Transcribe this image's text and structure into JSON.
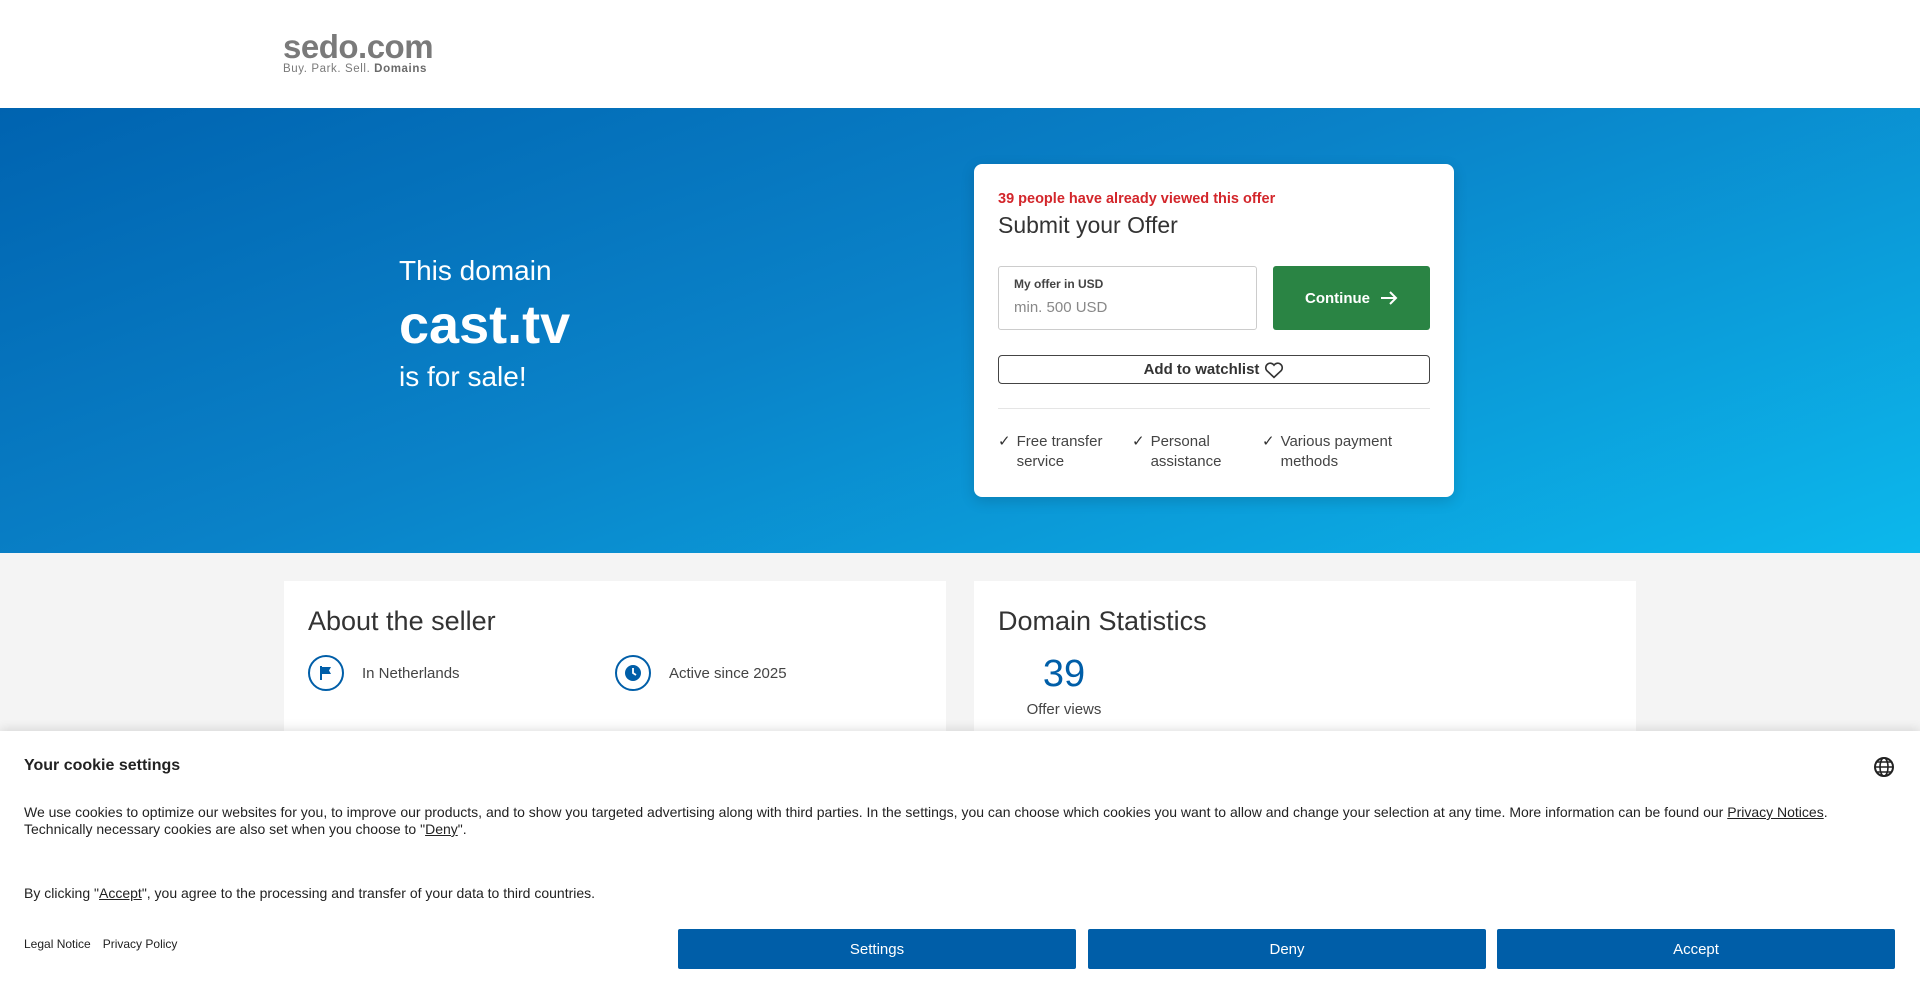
{
  "header": {
    "logo_main": "sedo.com",
    "logo_tag": "Buy. Park. Sell.",
    "logo_tag_bold": "Domains"
  },
  "hero": {
    "line1": "This domain",
    "domain": "cast.tv",
    "line3": "is for sale!"
  },
  "offer_card": {
    "views_notice": "39 people have already viewed this offer",
    "title": "Submit your Offer",
    "input_label": "My offer in USD",
    "input_placeholder": "min. 500 USD",
    "input_value": "",
    "continue_label": "Continue",
    "watchlist_label": "Add to watchlist",
    "features": [
      {
        "line1": "Free transfer",
        "line2": "service"
      },
      {
        "line1": "Personal",
        "line2": "assistance"
      },
      {
        "line1": "Various payment",
        "line2": "methods"
      }
    ]
  },
  "seller": {
    "title": "About the seller",
    "location": "In Netherlands",
    "active": "Active since 2025"
  },
  "stats": {
    "title": "Domain Statistics",
    "views_count": "39",
    "views_label": "Offer views"
  },
  "cookie": {
    "title": "Your cookie settings",
    "text_part1": "We use cookies to optimize our websites for you, to improve our products, and to show you targeted advertising along with third parties. In the settings, you can choose which cookies you want to allow and change your selection at any time. More information can be found our ",
    "privacy_notices_link": "Privacy Notices",
    "text_part2": ". Technically necessary cookies are also set when you choose to \"",
    "deny_link": "Deny",
    "text_part3": "\".",
    "agree_part1": "By clicking \"",
    "accept_link": "Accept",
    "agree_part2": "\", you agree to the processing and transfer of your data to third countries.",
    "legal_notice": "Legal Notice",
    "privacy_policy": "Privacy Policy",
    "settings_button": "Settings",
    "deny_button": "Deny",
    "accept_button": "Accept"
  },
  "colors": {
    "brand_blue": "#005ea8",
    "continue_green": "#2a8444",
    "alert_red": "#d3262b"
  }
}
